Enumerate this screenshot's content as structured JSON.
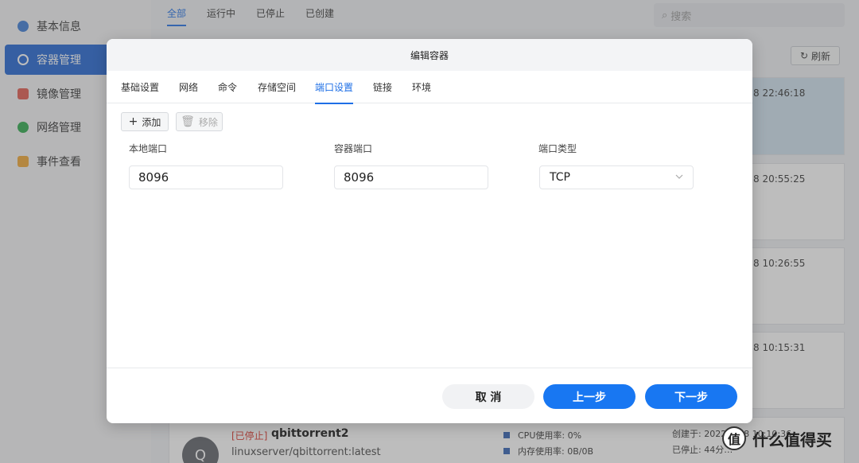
{
  "sidebar": {
    "items": [
      {
        "label": "基本信息",
        "icon": "gear-blue-icon",
        "color": "#3a7bd5"
      },
      {
        "label": "容器管理",
        "icon": "container-icon",
        "color": "#ffffff"
      },
      {
        "label": "镜像管理",
        "icon": "image-icon",
        "color": "#e2574c"
      },
      {
        "label": "网络管理",
        "icon": "globe-icon",
        "color": "#2ba84a"
      },
      {
        "label": "事件查看",
        "icon": "event-icon",
        "color": "#f1a531"
      }
    ]
  },
  "top_tabs": [
    "全部",
    "运行中",
    "已停止",
    "已创建"
  ],
  "search": {
    "placeholder": "搜索"
  },
  "refresh_label": "刷新",
  "cards": [
    {
      "time": "8 22:46:18"
    },
    {
      "time": "8 20:55:25"
    },
    {
      "time": "8 10:26:55"
    },
    {
      "time": "8 10:15:31"
    }
  ],
  "bottom_card": {
    "avatar": "Q",
    "status": "[已停止]",
    "name": "qbittorrent2",
    "image": "linuxserver/qbittorrent:latest",
    "cpu": "CPU使用率: 0%",
    "mem": "内存使用率: 0B/0B",
    "created": "创建于: 2022-…18 10:10:36",
    "stopped": "已停止: 44分…"
  },
  "modal": {
    "title": "编辑容器",
    "tabs": [
      "基础设置",
      "网络",
      "命令",
      "存储空间",
      "端口设置",
      "链接",
      "环境"
    ],
    "active_tab": "端口设置",
    "add_label": "添加",
    "remove_label": "移除",
    "fields": {
      "local_port_label": "本地端口",
      "local_port_value": "8096",
      "container_port_label": "容器端口",
      "container_port_value": "8096",
      "port_type_label": "端口类型",
      "port_type_value": "TCP"
    },
    "footer": {
      "cancel": "取 消",
      "prev": "上一步",
      "next": "下一步"
    }
  },
  "watermark": {
    "text": "什么值得买",
    "logo": "值"
  }
}
